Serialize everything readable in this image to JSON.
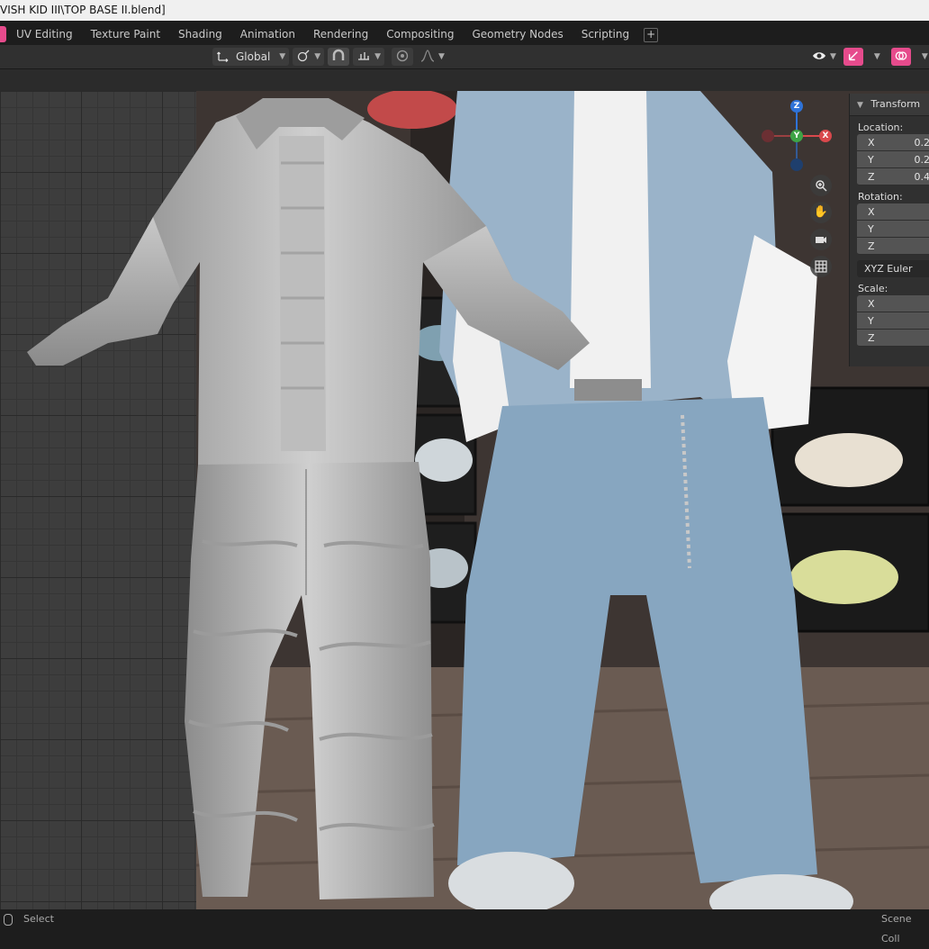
{
  "window": {
    "title": "VISH KID III\\TOP BASE II.blend]"
  },
  "tabs": [
    {
      "label": "UV Editing"
    },
    {
      "label": "Texture Paint"
    },
    {
      "label": "Shading"
    },
    {
      "label": "Animation"
    },
    {
      "label": "Rendering"
    },
    {
      "label": "Compositing"
    },
    {
      "label": "Geometry Nodes"
    },
    {
      "label": "Scripting"
    }
  ],
  "tab_add_label": "+",
  "header": {
    "orientation_label": "Global"
  },
  "gizmo": {
    "x": "X",
    "y": "Y",
    "z": "Z"
  },
  "npanel": {
    "title": "Transform",
    "location_label": "Location:",
    "location": [
      {
        "axis": "X",
        "value": "0.2"
      },
      {
        "axis": "Y",
        "value": "0.2"
      },
      {
        "axis": "Z",
        "value": "0.4"
      }
    ],
    "rotation_label": "Rotation:",
    "rotation": [
      {
        "axis": "X",
        "value": ""
      },
      {
        "axis": "Y",
        "value": ""
      },
      {
        "axis": "Z",
        "value": ""
      }
    ],
    "rotation_mode": "XYZ Euler",
    "scale_label": "Scale:",
    "scale": [
      {
        "axis": "X",
        "value": ""
      },
      {
        "axis": "Y",
        "value": ""
      },
      {
        "axis": "Z",
        "value": ""
      }
    ]
  },
  "status": {
    "left": "Select",
    "right": "Scene Coll"
  },
  "colors": {
    "accent": "#e64b8c",
    "panel_bg": "#303030",
    "field_bg": "#545454"
  }
}
